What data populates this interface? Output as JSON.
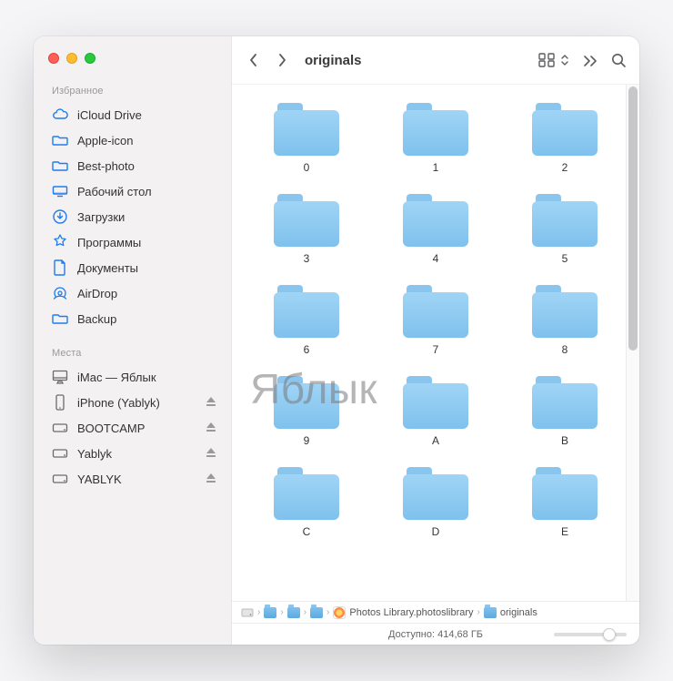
{
  "window": {
    "title": "originals"
  },
  "traffic": {
    "close": "close",
    "minimize": "minimize",
    "zoom": "zoom"
  },
  "sidebar": {
    "sections": {
      "favorites": {
        "label": "Избранное",
        "items": [
          {
            "icon": "cloud",
            "label": "iCloud Drive"
          },
          {
            "icon": "folder",
            "label": "Apple-icon"
          },
          {
            "icon": "folder",
            "label": "Best-photo"
          },
          {
            "icon": "desktop",
            "label": "Рабочий стол"
          },
          {
            "icon": "download",
            "label": "Загрузки"
          },
          {
            "icon": "apps",
            "label": "Программы"
          },
          {
            "icon": "doc",
            "label": "Документы"
          },
          {
            "icon": "airdrop",
            "label": "AirDrop"
          },
          {
            "icon": "folder",
            "label": "Backup"
          }
        ]
      },
      "locations": {
        "label": "Места",
        "items": [
          {
            "icon": "imac",
            "label": "iMac — Яблык",
            "eject": false
          },
          {
            "icon": "phone",
            "label": "iPhone (Yablyk)",
            "eject": true
          },
          {
            "icon": "drive",
            "label": "BOOTCAMP",
            "eject": true
          },
          {
            "icon": "drive",
            "label": "Yablyk",
            "eject": true
          },
          {
            "icon": "drive",
            "label": "YABLYK",
            "eject": true
          }
        ]
      }
    }
  },
  "folders": [
    "0",
    "1",
    "2",
    "3",
    "4",
    "5",
    "6",
    "7",
    "8",
    "9",
    "A",
    "B",
    "C",
    "D",
    "E"
  ],
  "path": {
    "lib": "Photos Library.photoslibrary",
    "current": "originals"
  },
  "status": {
    "text": "Доступно: 414,68 ГБ"
  },
  "watermark": "Яблык"
}
